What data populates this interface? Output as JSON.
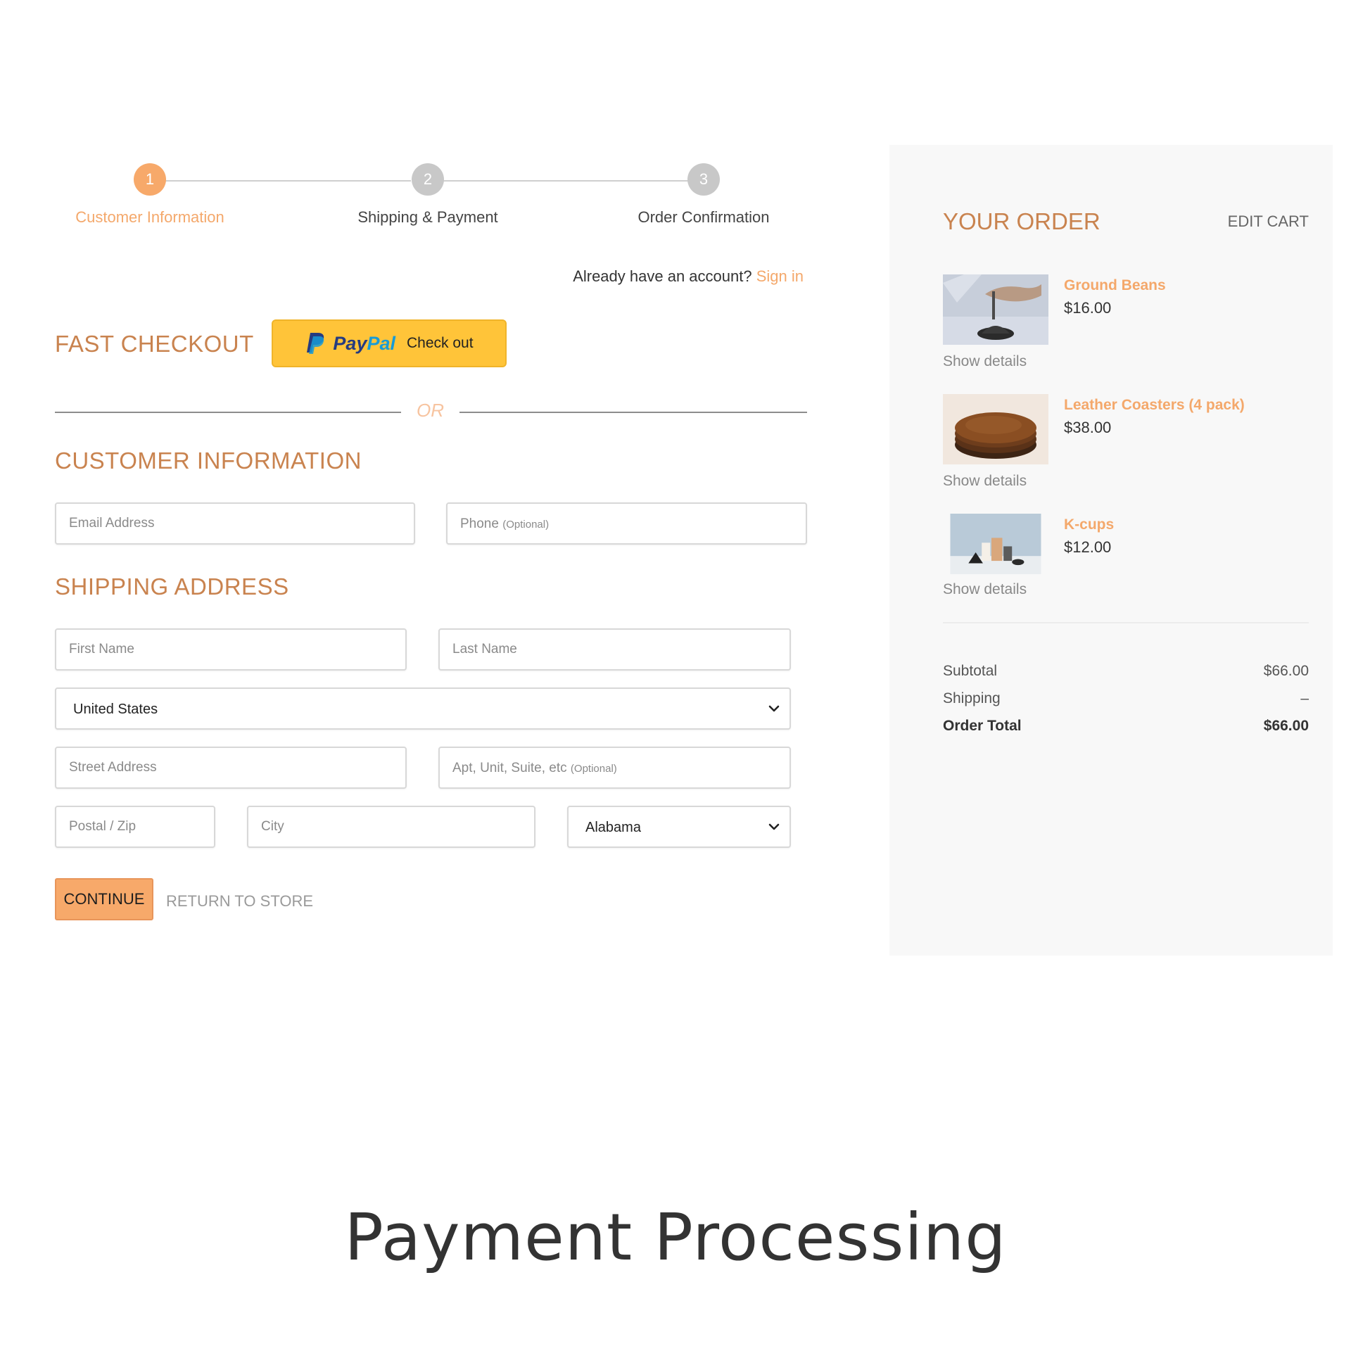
{
  "stepper": {
    "steps": [
      {
        "number": "1",
        "label": "Customer Information",
        "state": "active"
      },
      {
        "number": "2",
        "label": "Shipping & Payment",
        "state": "inactive"
      },
      {
        "number": "3",
        "label": "Order Confirmation",
        "state": "inactive"
      }
    ]
  },
  "account": {
    "prompt": "Already have an account?",
    "signin_label": "Sign in"
  },
  "fast_checkout": {
    "title": "FAST CHECKOUT",
    "paypal_pay": "Pay",
    "paypal_pal": "Pal",
    "paypal_action": "Check out"
  },
  "divider": {
    "or_label": "OR"
  },
  "customer_info": {
    "title": "CUSTOMER INFORMATION",
    "email_placeholder": "Email Address",
    "phone_placeholder": "Phone",
    "phone_hint": "(Optional)"
  },
  "shipping": {
    "title": "SHIPPING ADDRESS",
    "first_name_placeholder": "First Name",
    "last_name_placeholder": "Last Name",
    "country_value": "United States",
    "street_placeholder": "Street Address",
    "apt_placeholder": "Apt, Unit, Suite, etc",
    "apt_hint": "(Optional)",
    "postal_placeholder": "Postal / Zip",
    "city_placeholder": "City",
    "state_value": "Alabama"
  },
  "actions": {
    "continue_label": "CONTINUE",
    "return_label": "RETURN TO STORE"
  },
  "order": {
    "title": "YOUR ORDER",
    "edit_cart_label": "EDIT CART",
    "items": [
      {
        "name": "Ground Beans",
        "price": "$16.00",
        "details_label": "Show details"
      },
      {
        "name": "Leather Coasters (4 pack)",
        "price": "$38.00",
        "details_label": "Show details"
      },
      {
        "name": "K-cups",
        "price": "$12.00",
        "details_label": "Show details"
      }
    ],
    "summary": {
      "subtotal_label": "Subtotal",
      "subtotal_value": "$66.00",
      "shipping_label": "Shipping",
      "shipping_value": "–",
      "total_label": "Order Total",
      "total_value": "$66.00"
    }
  },
  "caption": "Payment Processing",
  "colors": {
    "accent": "#f7a96a",
    "heading": "#c9834f",
    "paypal_yellow": "#ffc439",
    "panel_bg": "#f8f8f8"
  },
  "icons": [
    "paypal-logo-icon",
    "chevron-down-icon"
  ]
}
